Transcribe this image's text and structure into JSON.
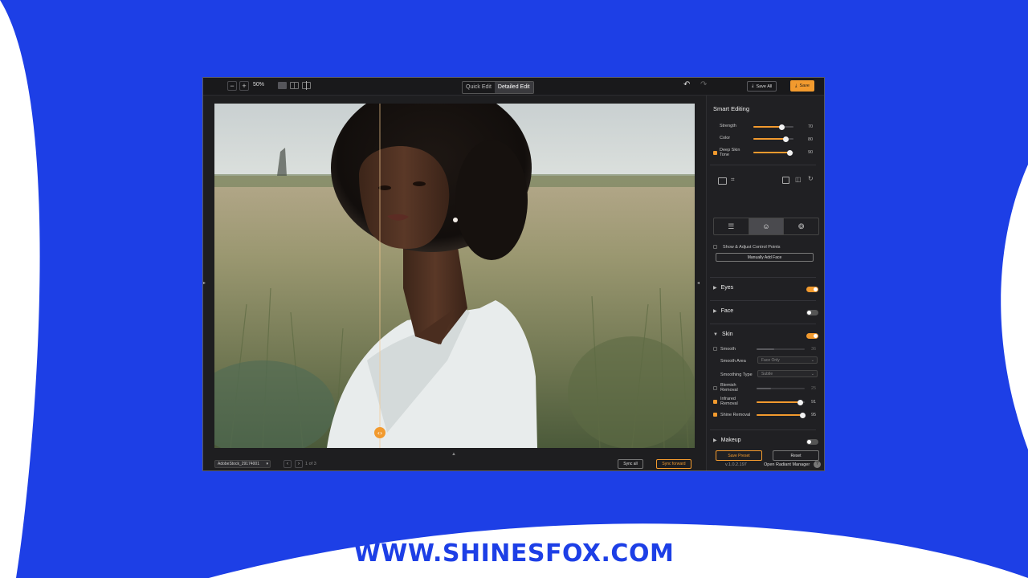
{
  "colors": {
    "brand_blue": "#1d3fe6",
    "accent_orange": "#f29a2e",
    "app_bg": "#1e1e20"
  },
  "toolbar": {
    "zoom_out_icon": "minus-icon",
    "zoom_in_icon": "plus-icon",
    "zoom_level": "50%",
    "modes": [
      "Quick Edit",
      "Detailed Edit"
    ],
    "active_mode": "Detailed Edit",
    "save_all_label": "Save All",
    "save_label": "Save"
  },
  "smart_editing": {
    "title": "Smart Editing",
    "sliders": [
      {
        "label": "Strength",
        "value": 70,
        "checkbox": false
      },
      {
        "label": "Color",
        "value": 80,
        "checkbox": false
      },
      {
        "label": "Deep Skin\nTone",
        "value": 90,
        "checkbox": true,
        "checked": true
      }
    ]
  },
  "controls": {
    "show_points_label": "Show & Adjust Control Points",
    "add_face_label": "Manually Add Face"
  },
  "sections": {
    "eyes": {
      "label": "Eyes",
      "enabled": true
    },
    "face": {
      "label": "Face",
      "enabled": false
    },
    "skin": {
      "label": "Skin",
      "enabled": true
    },
    "makeup": {
      "label": "Makeup",
      "enabled": false
    }
  },
  "skin": {
    "smooth": {
      "label": "Smooth",
      "value": 36
    },
    "smooth_area": {
      "label": "Smooth Area",
      "value": "Face Only"
    },
    "smoothing_type": {
      "label": "Smoothing Type",
      "value": "Subtle"
    },
    "blemish": {
      "label": "Blemish\nRemoval",
      "value": 25
    },
    "infrared": {
      "label": "Infrared\nRemoval",
      "value": 91
    },
    "shine": {
      "label": "Shine Removal",
      "value": 95
    }
  },
  "panel_buttons": {
    "save_preset": "Save Preset",
    "reset": "Reset"
  },
  "panel_footer": {
    "version": "v.1.0.2.197",
    "manager": "Open Radiant Manager"
  },
  "bottom": {
    "filename": "AdobeStock_29174001",
    "page": "1 of 3",
    "sync_all": "Sync all",
    "sync_forward": "Sync forward"
  },
  "watermark": {
    "url": "WWW.SHINESFOX.COM"
  }
}
